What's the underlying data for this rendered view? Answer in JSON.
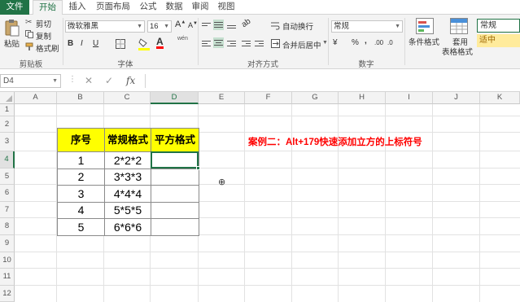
{
  "tabs": [
    "文件",
    "开始",
    "插入",
    "页面布局",
    "公式",
    "数据",
    "审阅",
    "视图"
  ],
  "active_tab": "开始",
  "clipboard": {
    "paste": "粘贴",
    "cut": "剪切",
    "copy": "复制",
    "format_painter": "格式刷",
    "label": "剪贴板"
  },
  "font": {
    "name": "微软雅黑",
    "size": "16",
    "bold": "B",
    "italic": "I",
    "underline": "U",
    "font_color_glyph": "A",
    "wen": "wén",
    "label": "字体"
  },
  "alignment": {
    "wrap_text": "自动换行",
    "merge_center": "合并后居中",
    "label": "对齐方式"
  },
  "number": {
    "format": "常规",
    "currency": "¥",
    "percent": "%",
    "comma": ",",
    "label": "数字"
  },
  "styles": {
    "conditional_formatting": "条件格式",
    "format_as_table_line1": "套用",
    "format_as_table_line2": "表格格式",
    "normal_style": "常规",
    "good_style": "适中"
  },
  "formula_bar": {
    "name_box": "D4",
    "cancel": "✕",
    "enter": "✓",
    "fx": "fx",
    "content": ""
  },
  "columns": [
    "A",
    "B",
    "C",
    "D",
    "E",
    "F",
    "G",
    "H",
    "I",
    "J",
    "K"
  ],
  "rows": [
    "1",
    "2",
    "3",
    "4",
    "5",
    "6",
    "7",
    "8",
    "9",
    "10",
    "11",
    "12"
  ],
  "selected_cell": "D4",
  "table": {
    "headers": [
      "序号",
      "常规格式",
      "平方格式"
    ],
    "rows": [
      [
        "1",
        "2*2*2",
        ""
      ],
      [
        "2",
        "3*3*3",
        ""
      ],
      [
        "3",
        "4*4*4",
        ""
      ],
      [
        "4",
        "5*5*5",
        ""
      ],
      [
        "5",
        "6*6*6",
        ""
      ]
    ]
  },
  "note": "案例二：Alt+179快速添加立方的上标符号",
  "colors": {
    "accent": "#217346",
    "header_fill": "#ffff00",
    "note": "#ff0000",
    "good_fill": "#ffeb9c"
  }
}
